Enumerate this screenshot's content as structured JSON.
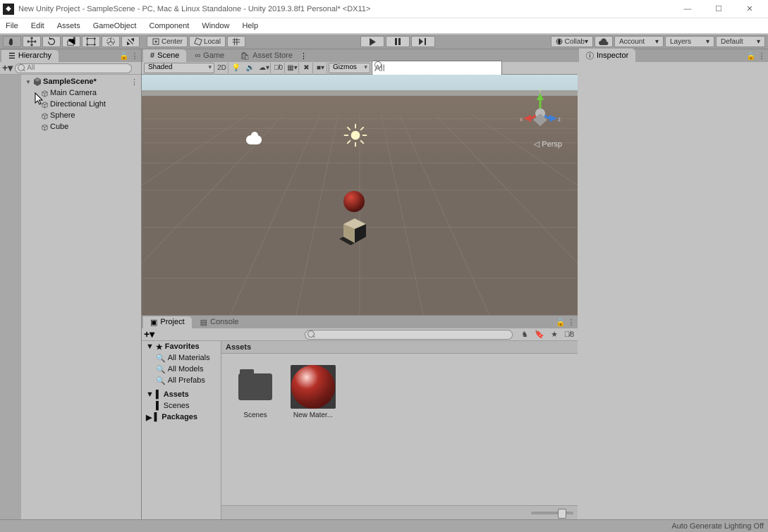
{
  "window": {
    "title": "New Unity Project - SampleScene - PC, Mac & Linux Standalone - Unity 2019.3.8f1 Personal* <DX11>"
  },
  "menu": [
    "File",
    "Edit",
    "Assets",
    "GameObject",
    "Component",
    "Window",
    "Help"
  ],
  "toolbar": {
    "center": "Center",
    "local": "Local",
    "collab": "Collab",
    "account": "Account",
    "layers": "Layers",
    "layout": "Default"
  },
  "panels": {
    "hierarchy": "Hierarchy",
    "scene": "Scene",
    "game": "Game",
    "assetstore": "Asset Store",
    "project": "Project",
    "console": "Console",
    "inspector": "Inspector"
  },
  "hierarchy": {
    "search": {
      "placeholder": "All"
    },
    "root": "SampleScene*",
    "items": [
      "Main Camera",
      "Directional Light",
      "Sphere",
      "Cube"
    ]
  },
  "scene": {
    "shading": "Shaded",
    "mode2d": "2D",
    "gizmos": "Gizmos",
    "searchPlaceholder": "All",
    "hiddenCount": "0",
    "persp": "Persp",
    "axis": {
      "x": "x",
      "y": "y",
      "z": "z"
    }
  },
  "project": {
    "favorites": "Favorites",
    "favItems": [
      "All Materials",
      "All Models",
      "All Prefabs"
    ],
    "assets": "Assets",
    "assetsChildren": [
      "Scenes"
    ],
    "packages": "Packages",
    "breadcrumb": "Assets",
    "gridItems": [
      {
        "name": "Scenes",
        "type": "folder"
      },
      {
        "name": "New Mater...",
        "type": "material"
      }
    ],
    "hiddenBadge": "8"
  },
  "status": {
    "msg": "Auto Generate Lighting Off"
  }
}
